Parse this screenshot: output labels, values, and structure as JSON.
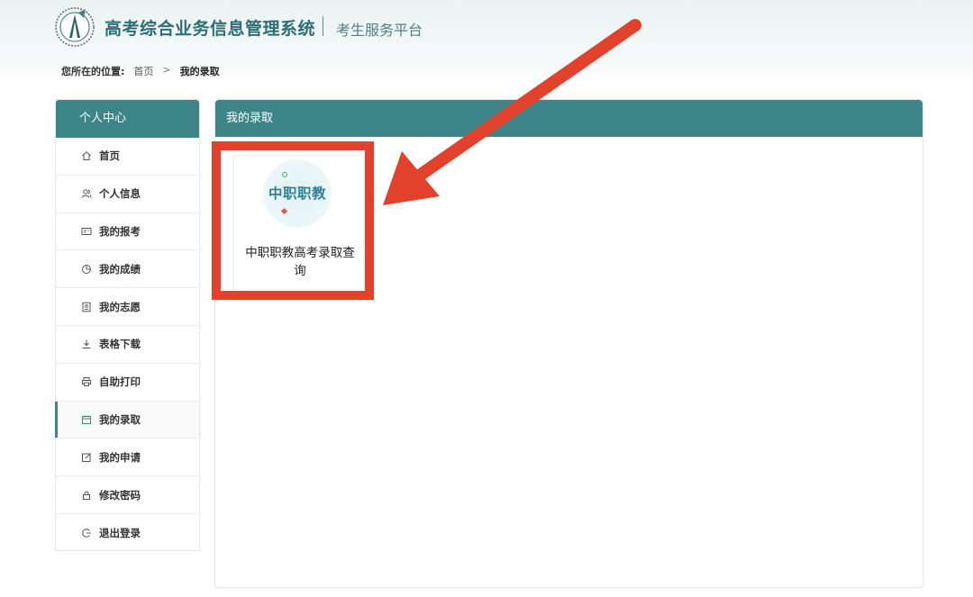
{
  "header": {
    "system_title": "高考综合业务信息管理系统",
    "subtitle": "考生服务平台"
  },
  "breadcrumb": {
    "label": "您所在的位置:",
    "home": "首页",
    "separator": ">",
    "current": "我的录取"
  },
  "sidebar": {
    "title": "个人中心",
    "items": [
      {
        "label": "首页",
        "icon": "home-icon"
      },
      {
        "label": "个人信息",
        "icon": "users-icon"
      },
      {
        "label": "我的报考",
        "icon": "id-card-icon"
      },
      {
        "label": "我的成绩",
        "icon": "pie-chart-icon"
      },
      {
        "label": "我的志愿",
        "icon": "document-icon"
      },
      {
        "label": "表格下载",
        "icon": "download-icon"
      },
      {
        "label": "自助打印",
        "icon": "printer-icon"
      },
      {
        "label": "我的录取",
        "icon": "calendar-icon",
        "active": true
      },
      {
        "label": "我的申请",
        "icon": "edit-icon"
      },
      {
        "label": "修改密码",
        "icon": "lock-icon"
      },
      {
        "label": "退出登录",
        "icon": "logout-icon"
      }
    ]
  },
  "main": {
    "title": "我的录取",
    "cards": [
      {
        "logo_text": "中职职教",
        "title": "中职职教高考录取查询"
      }
    ]
  },
  "colors": {
    "primary": "#3e8589",
    "title_text": "#2d6e73",
    "annotation_red": "#e2412c"
  }
}
